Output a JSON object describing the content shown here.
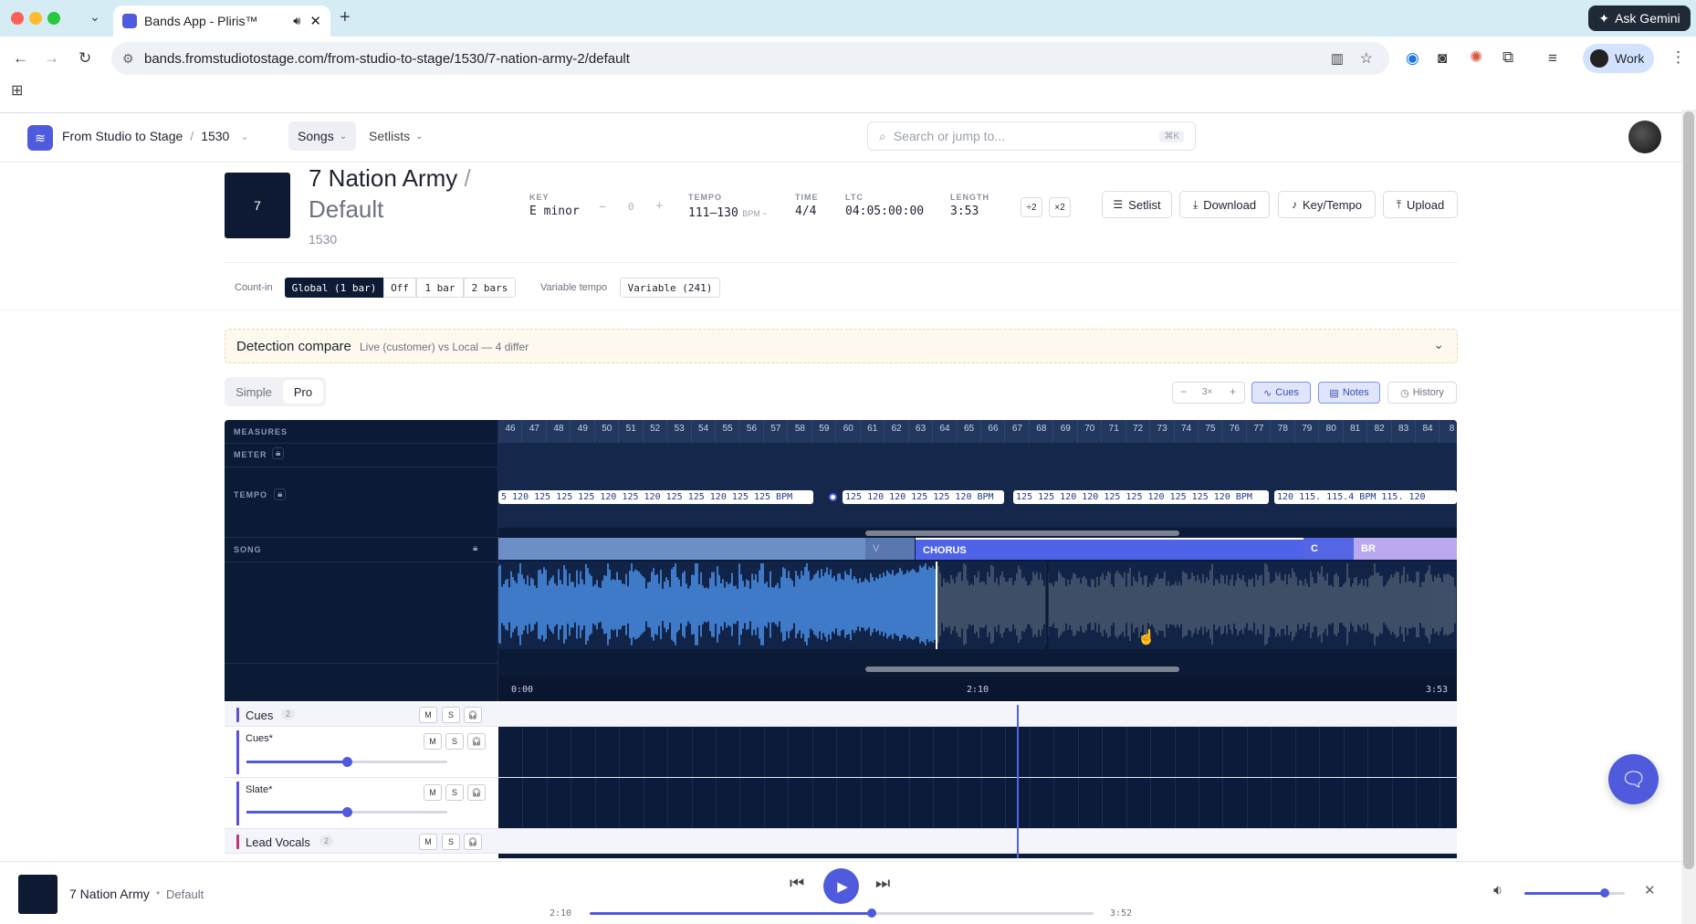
{
  "browser": {
    "tab_title": "Bands App - Pliris™",
    "url": "bands.fromstudiotostage.com/from-studio-to-stage/1530/7-nation-army-2/default",
    "ask_gemini": "Ask Gemini",
    "profile": "Work"
  },
  "header": {
    "org": "From Studio to Stage",
    "sep": "/",
    "project": "1530",
    "nav_songs": "Songs",
    "nav_setlists": "Setlists",
    "search_placeholder": "Search or jump to...",
    "search_shortcut": "⌘K"
  },
  "song": {
    "thumb_label": "7",
    "title": "7 Nation Army",
    "title_sep": "/",
    "version": "Default",
    "project_code": "1530",
    "key_label": "KEY",
    "key_value": "E minor",
    "key_minus": "−",
    "key_offset": "0",
    "key_plus": "+",
    "tempo_label": "TEMPO",
    "tempo_value": "111–130",
    "tempo_unit": "BPM ~",
    "time_label": "TIME",
    "time_value": "4/4",
    "ltc_label": "LTC",
    "ltc_value": "04:05:00:00",
    "length_label": "LENGTH",
    "length_value": "3:53",
    "half_badge": "÷2",
    "double_badge": "×2"
  },
  "actions": {
    "setlist": "Setlist",
    "download": "Download",
    "key_tempo": "Key/Tempo",
    "upload": "Upload"
  },
  "countin": {
    "label": "Count-in",
    "options": [
      "Global (1 bar)",
      "Off",
      "1 bar",
      "2 bars"
    ],
    "variable_label": "Variable tempo",
    "variable_value": "Variable (241)"
  },
  "detection": {
    "title": "Detection compare",
    "subtitle": "Live (customer) vs Local — 4 differ"
  },
  "mode": {
    "simple": "Simple",
    "pro": "Pro",
    "zoom_minus": "−",
    "zoom_value": "3×",
    "zoom_plus": "+",
    "cues": "Cues",
    "notes": "Notes",
    "history": "History"
  },
  "timeline": {
    "measures_label": "MEASURES",
    "meter_label": "METER",
    "tempo_label": "TEMPO",
    "song_label": "SONG",
    "measures": [
      "46",
      "47",
      "48",
      "49",
      "50",
      "51",
      "52",
      "53",
      "54",
      "55",
      "56",
      "57",
      "58",
      "59",
      "60",
      "61",
      "62",
      "63",
      "64",
      "65",
      "66",
      "67",
      "68",
      "69",
      "70",
      "71",
      "72",
      "73",
      "74",
      "75",
      "76",
      "77",
      "78",
      "79",
      "80",
      "81",
      "82",
      "83",
      "84",
      "8"
    ],
    "tempo_group_1": "5 120 125 125 125 120 125 120 125 125 120 125 125 BPM",
    "tempo_group_2": "125 120 120 125 125 120 BPM",
    "tempo_group_3": "125 125 120 120 125 125 120 125 125 120 BPM",
    "tempo_group_4": "120 115. 115.4 BPM 115. 120",
    "sections": {
      "v": "V",
      "chorus": "CHORUS",
      "c": "C",
      "br": "BR"
    },
    "time_start": "0:00",
    "time_mid": "2:10",
    "time_end": "3:53"
  },
  "tracks": {
    "cues_group": "Cues",
    "cues_count": "2",
    "cues_track": "Cues*",
    "slate_track": "Slate*",
    "lead_group": "Lead Vocals",
    "lead_count": "2",
    "m": "M",
    "s": "S"
  },
  "player": {
    "title": "7 Nation Army",
    "dot": "•",
    "version": "Default",
    "elapsed": "2:10",
    "remaining": "3:52",
    "progress": 0.56,
    "volume": 0.8
  },
  "colors": {
    "accent": "#4f5bdc",
    "timeline_bg": "#0b1a35",
    "waveform_played": "#4a90e8",
    "waveform_unplayed": "#4b5a70",
    "chorus": "#4f63e8",
    "bridge": "#b9a8ee"
  }
}
